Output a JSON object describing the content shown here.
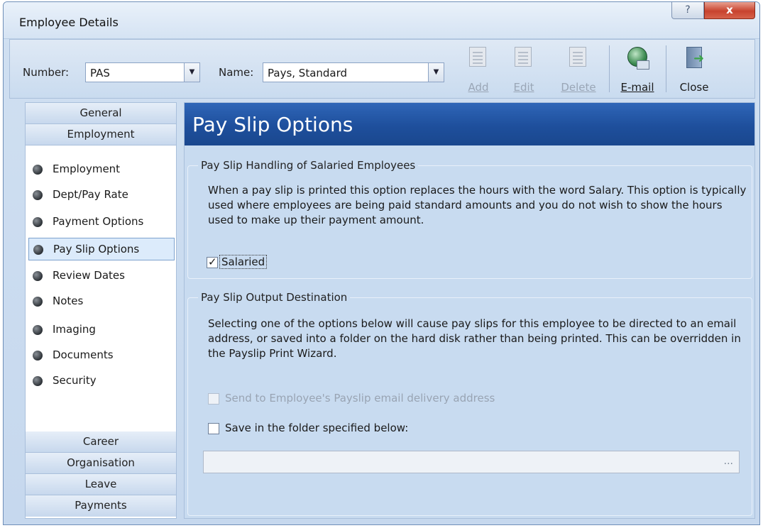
{
  "window": {
    "title": "Employee Details",
    "help_label": "?",
    "close_label": "x"
  },
  "toolbar": {
    "number_label": "Number:",
    "number_value": "PAS",
    "name_label": "Name:",
    "name_value": "Pays, Standard",
    "buttons": [
      {
        "label": "Add",
        "icon": "add-doc-icon",
        "enabled": false
      },
      {
        "label": "Edit",
        "icon": "edit-doc-icon",
        "enabled": false
      },
      {
        "label": "Delete",
        "icon": "delete-doc-icon",
        "enabled": false
      },
      {
        "label": "E-mail",
        "icon": "email-globe-icon",
        "enabled": true
      },
      {
        "label": "Close",
        "icon": "exit-door-icon",
        "enabled": true
      }
    ]
  },
  "nav": {
    "sections_top": [
      "General",
      "Employment"
    ],
    "items": [
      "Employment",
      "Dept/Pay Rate",
      "Payment Options",
      "Pay Slip Options",
      "Review Dates",
      "Notes",
      "Imaging",
      "Documents",
      "Security"
    ],
    "active_item": "Pay Slip Options",
    "sections_bottom": [
      "Career",
      "Organisation",
      "Leave",
      "Payments"
    ]
  },
  "content": {
    "title": "Pay Slip Options",
    "group1": {
      "title": "Pay Slip Handling of Salaried Employees",
      "description": "When a pay slip is printed this option replaces the hours with the word Salary. This option is typically used where employees are being paid standard amounts and you do not wish to show the hours used to make up their payment amount.",
      "salaried_label": "Salaried",
      "salaried_checked": true
    },
    "group2": {
      "title": "Pay Slip Output Destination",
      "description": "Selecting one of the options below will cause pay slips for this employee to be directed to an email address, or saved into a folder on the hard disk rather than being printed. This can be overridden in the Payslip Print Wizard.",
      "email_label": "Send to Employee's Payslip email delivery address",
      "email_checked": false,
      "email_enabled": false,
      "folder_label": "Save in the folder specified below:",
      "folder_checked": false,
      "folder_value": "",
      "browse_label": "..."
    }
  },
  "colors": {
    "banner": "#1e4f9c",
    "content_bg": "#c8dbf0",
    "nav_active": "#dcebfb"
  }
}
